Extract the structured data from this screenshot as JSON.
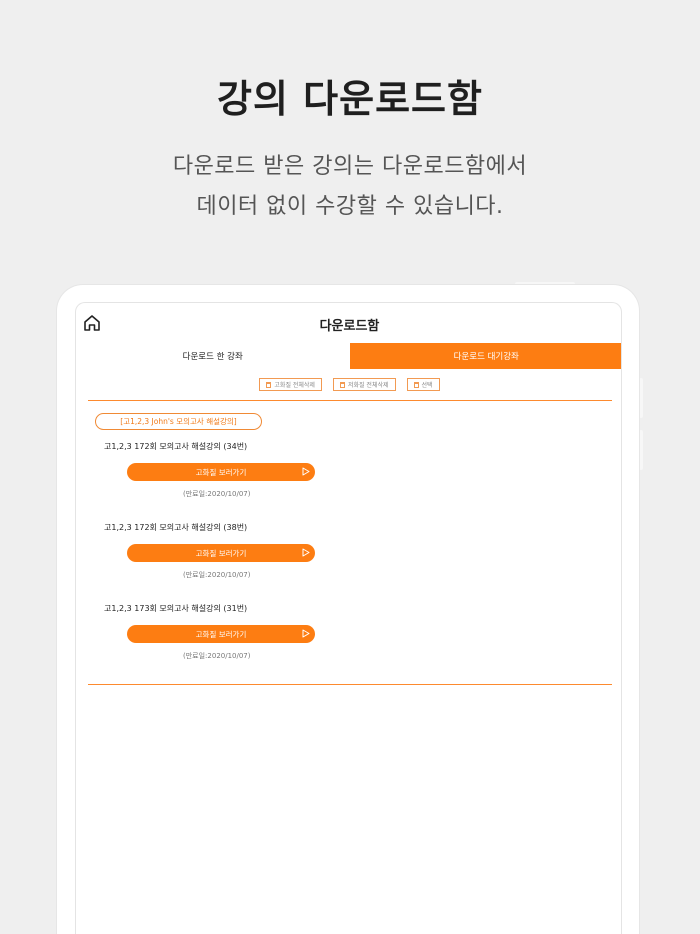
{
  "promo": {
    "headline": "강의 다운로드함",
    "sub_line1": "다운로드 받은 강의는 다운로드함에서",
    "sub_line2": "데이터 없이 수강할 수 있습니다."
  },
  "app": {
    "title": "다운로드함",
    "home_icon": "home-icon",
    "tabs": [
      {
        "label": "다운로드 한 강좌",
        "active": false
      },
      {
        "label": "다운로드 대기강좌",
        "active": true
      }
    ],
    "toolbar": {
      "hq_delete_all": "고화질 전체삭제",
      "lq_delete_all": "저화질 전체삭제",
      "select": "선택"
    },
    "category": "[고1,2,3 John's 모의고사 해설강의]",
    "lectures": [
      {
        "title": "고1,2,3 172회 모의고사 해설강의 (34번)",
        "button": "고화질 보러가기",
        "expire": "(만료일:2020/10/07)"
      },
      {
        "title": "고1,2,3 172회 모의고사 해설강의 (38번)",
        "button": "고화질 보러가기",
        "expire": "(만료일:2020/10/07)"
      },
      {
        "title": "고1,2,3 173회 모의고사 해설강의 (31번)",
        "button": "고화질 보러가기",
        "expire": "(만료일:2020/10/07)"
      }
    ],
    "accent_color": "#fd7d12"
  }
}
